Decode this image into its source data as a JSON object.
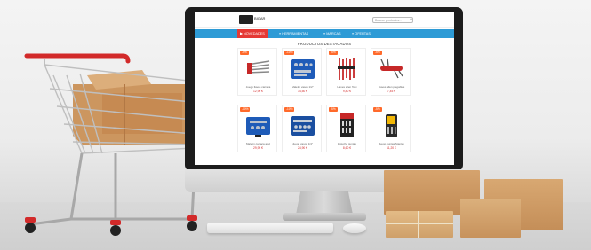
{
  "site": {
    "logo_text": "BIGAR",
    "search_placeholder": "Buscar productos..."
  },
  "nav": {
    "items": [
      {
        "label": "▶ NOVEDADES"
      },
      {
        "label": "≡ HERRAMIENTAS"
      },
      {
        "label": "≡ MARCAS"
      },
      {
        "label": "≡ OFERTAS"
      }
    ]
  },
  "section": {
    "title": "PRODUCTOS DESTACADOS"
  },
  "products": [
    {
      "badge": "-5%",
      "name": "Juego llaves carraca",
      "price": "12,90 €",
      "icon": "ratchet-wrench-set-icon"
    },
    {
      "badge": "-10%",
      "name": "Maletín vasos 1/2\"",
      "price": "34,50 €",
      "icon": "blue-socket-case-icon"
    },
    {
      "badge": "-5%",
      "name": "Llaves allen Torx",
      "price": "9,80 €",
      "icon": "red-hex-key-set-icon"
    },
    {
      "badge": "-5%",
      "name": "Llaves allen plegables",
      "price": "7,45 €",
      "icon": "folding-hex-keys-icon"
    },
    {
      "badge": "-10%",
      "name": "Maletín carraca azul",
      "price": "29,95 €",
      "icon": "blue-toolbox-icon"
    },
    {
      "badge": "-10%",
      "name": "Juego vasos 1/4\"",
      "price": "24,90 €",
      "icon": "open-socket-case-icon"
    },
    {
      "badge": "-5%",
      "name": "Estuche puntas",
      "price": "8,60 €",
      "icon": "bit-set-card-icon"
    },
    {
      "badge": "-5%",
      "name": "Juego puntas Stanley",
      "price": "11,20 €",
      "icon": "bit-holder-set-icon"
    }
  ],
  "colors": {
    "nav": "#2e9bd6",
    "nav_active": "#e53935",
    "badge": "#ff6a2b",
    "price": "#d32f2f",
    "cart_red": "#d22a2a",
    "cardboard": "#cf9a63"
  }
}
